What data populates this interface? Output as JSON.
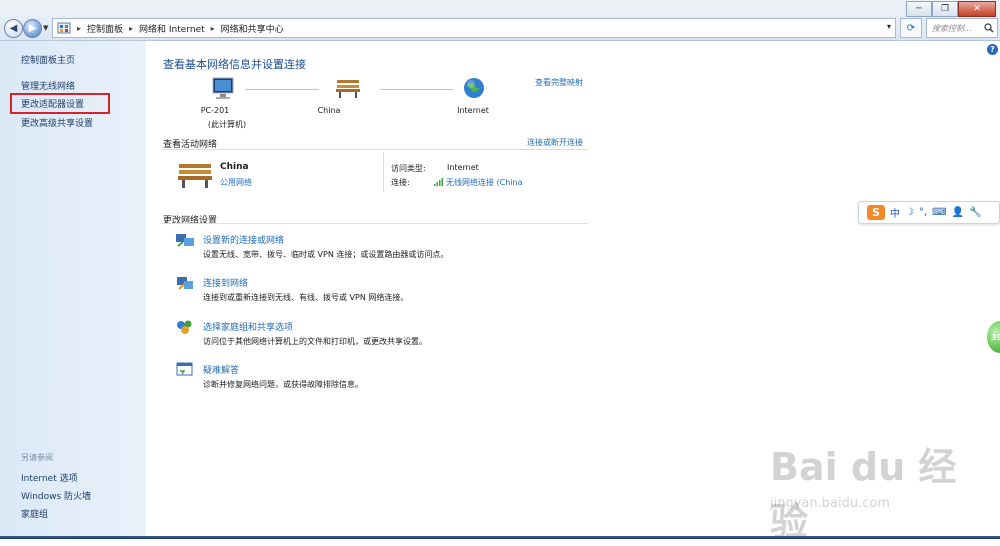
{
  "window": {
    "min_glyph": "─",
    "max_glyph": "❐",
    "close_glyph": "✕"
  },
  "address": {
    "crumbs": [
      "控制面板",
      "网络和 Internet",
      "网络和共享中心"
    ],
    "search_placeholder": "搜索控制..."
  },
  "sidebar": {
    "links": [
      "控制面板主页",
      "管理无线网络",
      "更改适配器设置",
      "更改高级共享设置"
    ],
    "see_also_title": "另请参阅",
    "see_also": [
      "Internet 选项",
      "Windows 防火墙",
      "家庭组"
    ]
  },
  "main": {
    "title": "查看基本网络信息并设置连接",
    "view_full_map": "查看完整映射",
    "map": {
      "pc_name": "PC-201",
      "pc_sub": "(此计算机)",
      "network": "China",
      "internet": "Internet"
    },
    "active": {
      "section": "查看活动网络",
      "connect_link": "连接或断开连接",
      "name": "China",
      "type": "公用网络",
      "access_label": "访问类型:",
      "access_value": "Internet",
      "conn_label": "连接:",
      "conn_value": "无线网络连接 (China"
    },
    "change": {
      "section": "更改网络设置",
      "tasks": [
        {
          "title": "设置新的连接或网络",
          "desc": "设置无线、宽带、拨号、临时或 VPN 连接；或设置路由器或访问点。"
        },
        {
          "title": "连接到网络",
          "desc": "连接到或重新连接到无线、有线、拨号或 VPN 网络连接。"
        },
        {
          "title": "选择家庭组和共享选项",
          "desc": "访问位于其他网络计算机上的文件和打印机，或更改共享设置。"
        },
        {
          "title": "疑难解答",
          "desc": "诊断并修复网络问题，或获得故障排除信息。"
        }
      ]
    }
  },
  "ime": {
    "logo": "S",
    "mode": "中"
  },
  "badge": "39",
  "watermark": {
    "big": "Bai du 经验",
    "small": "jingyan.baidu.com"
  }
}
